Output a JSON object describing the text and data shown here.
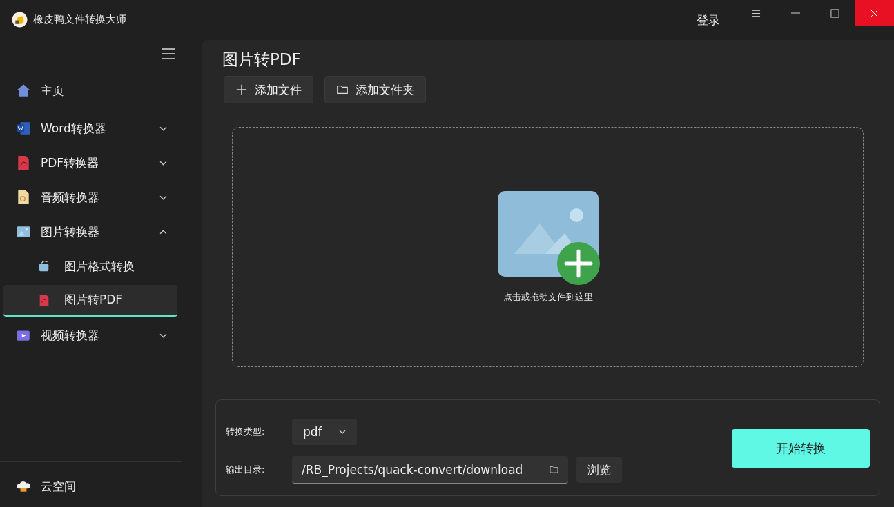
{
  "app": {
    "title": "橡皮鸭文件转换大师",
    "login": "登录"
  },
  "sidebar": {
    "items": [
      {
        "kind": "link",
        "label": "主页",
        "selected": false
      },
      {
        "kind": "group",
        "label": "Word转换器",
        "expanded": false,
        "selected": false
      },
      {
        "kind": "group",
        "label": "PDF转换器",
        "expanded": false,
        "selected": false
      },
      {
        "kind": "group",
        "label": "音频转换器",
        "expanded": false,
        "selected": false
      },
      {
        "kind": "group",
        "label": "图片转换器",
        "expanded": true,
        "selected": false,
        "children": [
          {
            "label": "图片格式转换",
            "selected": false
          },
          {
            "label": "图片转PDF",
            "selected": true
          }
        ]
      },
      {
        "kind": "group",
        "label": "视频转换器",
        "expanded": false,
        "selected": false
      }
    ],
    "footer": {
      "label": "云空间"
    }
  },
  "main": {
    "title": "图片转PDF",
    "buttons": [
      {
        "label": "添加文件"
      },
      {
        "label": "添加文件夹"
      }
    ],
    "dropzone": {
      "hint": "点击或拖动文件到这里"
    },
    "settings": {
      "type_label": "转换类型:",
      "type_value": "pdf",
      "output_label": "输出目录:",
      "output_path": "/RB_Projects/quack-convert/download",
      "browse": "浏览",
      "start": "开始转换"
    }
  }
}
